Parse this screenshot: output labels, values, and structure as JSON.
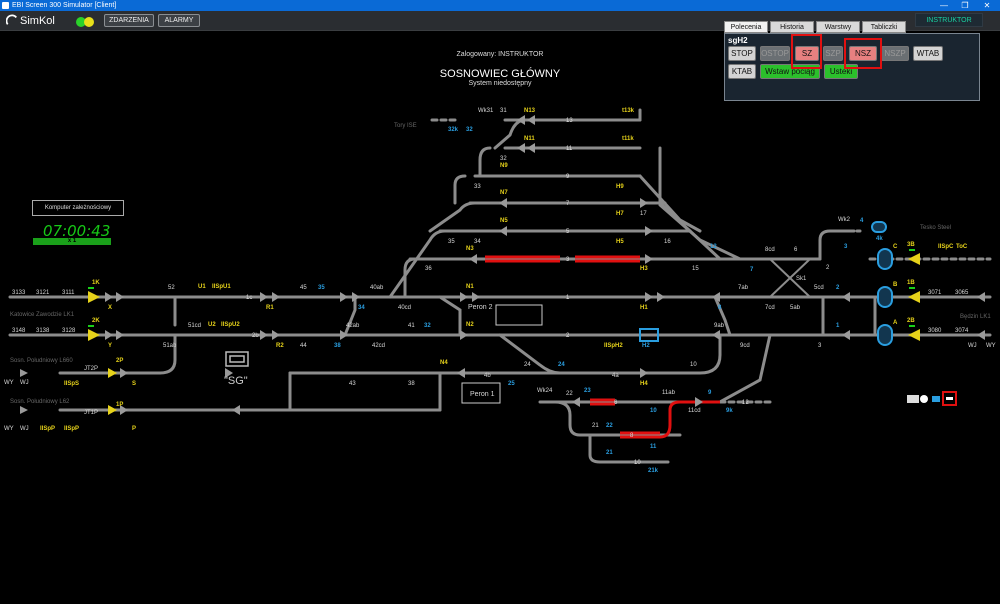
{
  "window": {
    "title": "EBI Screen 300 Simulator [Client]",
    "min": "—",
    "max": "❐",
    "close": "✕"
  },
  "header": {
    "logo": "SimKol",
    "events_btn": "ZDARZENIA",
    "alarms_btn": "ALARMY",
    "user": "INSTRUKTOR"
  },
  "panel": {
    "tabs": [
      "Polecenia",
      "Historia",
      "Warstwy",
      "Tabliczki"
    ],
    "object": "sgH2",
    "row1": [
      "STOP",
      "OSTOP",
      "SZ",
      "SZP",
      "NSZ",
      "NSZP",
      "WTAB"
    ],
    "row2": [
      "KTAB",
      "Wstaw pociąg",
      "Usteki"
    ]
  },
  "main": {
    "logged": "Zalogowany: INSTRUKTOR",
    "station": "SOSNOWIEC GŁÓWNY",
    "status": "System niedostępny",
    "interlock": "Komputer zależnościowy",
    "time": "07:00:43",
    "speed": "x 1",
    "sg": "\"SG\"",
    "peron1": "Peron 1",
    "peron2": "Peron 2"
  },
  "labels": {
    "tory_ise": "Tory ISE",
    "katowice": "Katowice Zawodzie LK1",
    "l660": "Sosn. Południowy L660",
    "l62": "Sosn. Południowy L62",
    "tesko": "Tesko Steel",
    "bedzin": "Będzin LK1",
    "wy": "WY",
    "wj": "WJ"
  },
  "colors": {
    "track": "#8c8c8c",
    "yellow": "#e6d21a",
    "blue": "#2a9ee0",
    "red": "#e01010",
    "green": "#19d019"
  }
}
